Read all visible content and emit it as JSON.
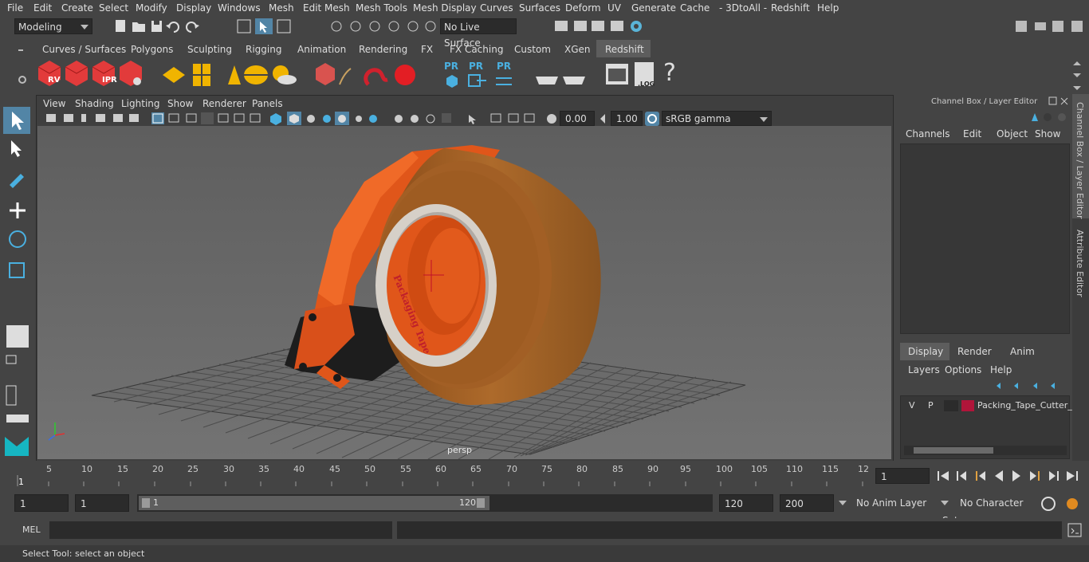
{
  "menubar": {
    "items": [
      "File",
      "Edit",
      "Create",
      "Select",
      "Modify",
      "Display",
      "Windows",
      "Mesh",
      "Edit Mesh",
      "Mesh Tools",
      "Mesh Display",
      "Curves",
      "Surfaces",
      "Deform",
      "UV",
      "Generate",
      "Cache",
      "- 3DtoAll -",
      "Redshift",
      "Help"
    ]
  },
  "statusline": {
    "mode": "Modeling",
    "live_surface": "No Live Surface"
  },
  "shelf": {
    "tabs": [
      "Curves / Surfaces",
      "Polygons",
      "Sculpting",
      "Rigging",
      "Animation",
      "Rendering",
      "FX",
      "FX Caching",
      "Custom",
      "XGen",
      "Redshift"
    ],
    "active_tab": "Redshift",
    "icon_labels": [
      "RV",
      "IPR",
      "PR",
      "PR",
      "PR",
      ".LOG",
      "?"
    ]
  },
  "viewport": {
    "menu": [
      "View",
      "Shading",
      "Lighting",
      "Show",
      "Renderer",
      "Panels"
    ],
    "exposure": "0.00",
    "gamma": "1.00",
    "color_space": "sRGB gamma",
    "camera_label": "persp",
    "tape_text": "Packaging Tape"
  },
  "channel_box": {
    "title": "Channel Box / Layer Editor",
    "menu": [
      "Channels",
      "Edit",
      "Object",
      "Show"
    ],
    "layer_tabs": [
      "Display",
      "Render",
      "Anim"
    ],
    "layer_menu": [
      "Layers",
      "Options",
      "Help"
    ],
    "layer": {
      "v": "V",
      "p": "P",
      "name": "Packing_Tape_Cutter_E",
      "color": "#b0153a"
    }
  },
  "side_tabs": {
    "channel_box": "Channel Box / Layer Editor",
    "attribute_editor": "Attribute Editor"
  },
  "timeline": {
    "ticks": [
      "5",
      "10",
      "15",
      "20",
      "25",
      "30",
      "35",
      "40",
      "45",
      "50",
      "55",
      "60",
      "65",
      "70",
      "75",
      "80",
      "85",
      "90",
      "95",
      "100",
      "105",
      "110",
      "115",
      "12"
    ],
    "current_frame_marker": "1",
    "current_frame": "1"
  },
  "range": {
    "start_field": "1",
    "playback_start": "1",
    "slider_start": "1",
    "slider_end": "120",
    "playback_end": "120",
    "end_field": "200",
    "anim_layer": "No Anim Layer",
    "character_set": "No Character Set"
  },
  "command": {
    "label": "MEL"
  },
  "help_line": {
    "text": "Select Tool: select an object"
  },
  "colors": {
    "accent": "#5285a6",
    "tape": "#a45f22",
    "dispenser": "#e0561a"
  }
}
